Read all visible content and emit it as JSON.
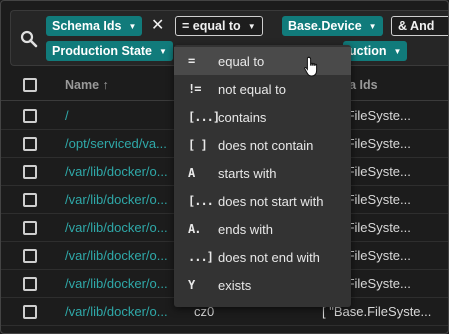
{
  "filter": {
    "chips": [
      {
        "label": "Schema Ids",
        "has_close": true,
        "close_glyph": "✕"
      },
      {
        "label": "= equal to"
      },
      {
        "label": "Base.Device"
      },
      {
        "label": "& And"
      },
      {
        "label": "Production State"
      },
      {
        "label": "uction"
      }
    ],
    "caret_glyph": "▼"
  },
  "table": {
    "columns": {
      "name": "Name",
      "name_sort": "↑",
      "schema": "ma Ids"
    },
    "rows": [
      {
        "name": "/",
        "schema": "ase.FileSyste..."
      },
      {
        "name": "/opt/serviced/va...",
        "schema": "ase.FileSyste..."
      },
      {
        "name": "/var/lib/docker/o...",
        "schema": "ase.FileSyste..."
      },
      {
        "name": "/var/lib/docker/o...",
        "schema": "ase.FileSyste..."
      },
      {
        "name": "/var/lib/docker/o...",
        "schema": "ase.FileSyste..."
      },
      {
        "name": "/var/lib/docker/o...",
        "schema": "ase.FileSyste..."
      },
      {
        "name": "/var/lib/docker/o...",
        "schema": "ase.FileSyste..."
      },
      {
        "name": "/var/lib/docker/o...",
        "prod": "cz0",
        "schema": "[ \"Base.FileSyste..."
      }
    ]
  },
  "menu": {
    "items": [
      {
        "icon": "=",
        "label": "equal to"
      },
      {
        "icon": "!=",
        "label": "not equal to"
      },
      {
        "icon": "[...]",
        "label": "contains"
      },
      {
        "icon": "[ ]",
        "label": "does not contain"
      },
      {
        "icon": "A",
        "label": "starts with"
      },
      {
        "icon": "[...",
        "label": "does not start with"
      },
      {
        "icon": "A.",
        "label": "ends with"
      },
      {
        "icon": "...]",
        "label": "does not end with"
      },
      {
        "icon": "Y",
        "label": "exists"
      }
    ]
  },
  "colors": {
    "accent": "#117b7b",
    "link": "#2fa9a9",
    "menu_bg": "#333333",
    "menu_hover": "#4a4a4a"
  }
}
